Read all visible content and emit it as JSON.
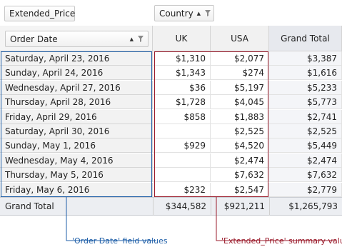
{
  "data_field": {
    "label": "Extended_Price"
  },
  "column_field": {
    "label": "Country",
    "sort": "ascending"
  },
  "row_field": {
    "label": "Order Date",
    "sort": "ascending"
  },
  "column_headers": [
    "UK",
    "USA",
    "Grand Total"
  ],
  "rows": [
    {
      "label": "Saturday, April 23, 2016",
      "uk": "$1,310",
      "usa": "$2,077",
      "total": "$3,387"
    },
    {
      "label": "Sunday, April 24, 2016",
      "uk": "$1,343",
      "usa": "$274",
      "total": "$1,616"
    },
    {
      "label": "Wednesday, April 27, 2016",
      "uk": "$36",
      "usa": "$5,197",
      "total": "$5,233"
    },
    {
      "label": "Thursday, April 28, 2016",
      "uk": "$1,728",
      "usa": "$4,045",
      "total": "$5,773"
    },
    {
      "label": "Friday, April 29, 2016",
      "uk": "$858",
      "usa": "$1,883",
      "total": "$2,741"
    },
    {
      "label": "Saturday, April 30, 2016",
      "uk": "",
      "usa": "$2,525",
      "total": "$2,525"
    },
    {
      "label": "Sunday, May 1, 2016",
      "uk": "$929",
      "usa": "$4,520",
      "total": "$5,449"
    },
    {
      "label": "Wednesday, May 4, 2016",
      "uk": "",
      "usa": "$2,474",
      "total": "$2,474"
    },
    {
      "label": "Thursday, May 5, 2016",
      "uk": "",
      "usa": "$7,632",
      "total": "$7,632"
    },
    {
      "label": "Friday, May 6, 2016",
      "uk": "$232",
      "usa": "$2,547",
      "total": "$2,779"
    }
  ],
  "grand_total": {
    "label": "Grand Total",
    "uk": "$344,582",
    "usa": "$921,211",
    "total": "$1,265,793"
  },
  "annotations": {
    "row_values": "'Order Date' field values",
    "summary_values": "'Extended_Price' summary values"
  },
  "colors": {
    "row_annotation": "#1f5fa8",
    "summary_annotation": "#9b1c2c"
  },
  "icons": {
    "sort": "sort-ascending-icon",
    "filter": "filter-icon"
  }
}
